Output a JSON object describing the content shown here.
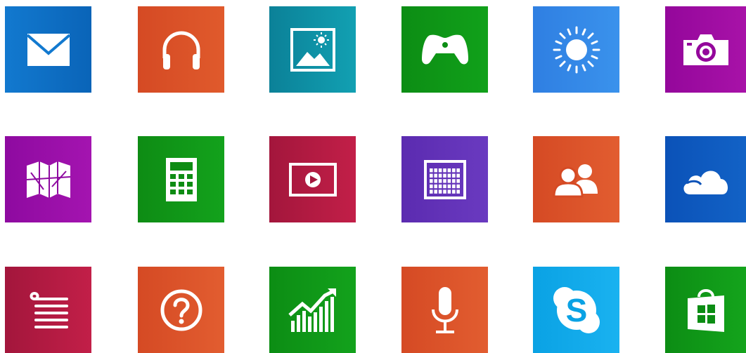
{
  "tiles": [
    {
      "name": "mail",
      "icon": "mail-icon",
      "color_a": "#1279cf",
      "color_b": "#0a64b8"
    },
    {
      "name": "music",
      "icon": "headphones-icon",
      "color_a": "#d54a24",
      "color_b": "#e05a2c"
    },
    {
      "name": "photos",
      "icon": "photo-icon",
      "color_a": "#0b8198",
      "color_b": "#12a0b2"
    },
    {
      "name": "games",
      "icon": "game-controller-icon",
      "color_a": "#0c8d14",
      "color_b": "#11a11a"
    },
    {
      "name": "weather",
      "icon": "sun-icon",
      "color_a": "#2f7fe2",
      "color_b": "#3a92ec"
    },
    {
      "name": "camera",
      "icon": "camera-icon",
      "color_a": "#94079b",
      "color_b": "#a812a8"
    },
    {
      "name": "maps",
      "icon": "map-icon",
      "color_a": "#8e0aa0",
      "color_b": "#a414b0"
    },
    {
      "name": "calculator",
      "icon": "calculator-icon",
      "color_a": "#0e8c14",
      "color_b": "#13a21c"
    },
    {
      "name": "video",
      "icon": "video-icon",
      "color_a": "#a3163c",
      "color_b": "#c21f48"
    },
    {
      "name": "calendar",
      "icon": "calendar-icon",
      "color_a": "#5b2bb0",
      "color_b": "#6a3ac0"
    },
    {
      "name": "people",
      "icon": "people-icon",
      "color_a": "#d54a24",
      "color_b": "#e25d30"
    },
    {
      "name": "onedrive",
      "icon": "cloud-icon",
      "color_a": "#0b52b8",
      "color_b": "#1262c6"
    },
    {
      "name": "reading-list",
      "icon": "reading-list-icon",
      "color_a": "#a3163c",
      "color_b": "#c21f48"
    },
    {
      "name": "help-tips",
      "icon": "help-icon",
      "color_a": "#d54a24",
      "color_b": "#e25d30"
    },
    {
      "name": "finance",
      "icon": "finance-chart-icon",
      "color_a": "#0c8d14",
      "color_b": "#13a21c"
    },
    {
      "name": "sound-recorder",
      "icon": "microphone-icon",
      "color_a": "#d54a24",
      "color_b": "#e25d30"
    },
    {
      "name": "skype",
      "icon": "skype-icon",
      "color_a": "#0aa2e4",
      "color_b": "#1ab2f0"
    },
    {
      "name": "store",
      "icon": "store-icon",
      "color_a": "#0c8d14",
      "color_b": "#14a41c"
    }
  ]
}
